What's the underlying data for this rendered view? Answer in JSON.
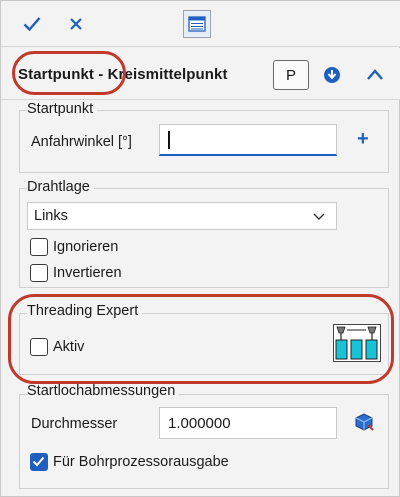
{
  "toolbar": {
    "ok_icon": "checkmark-icon",
    "cancel_icon": "close-icon",
    "table_icon": "table-icon"
  },
  "header": {
    "title": "Startpunkt - Kreismittelpunkt",
    "p_button": "P",
    "down_icon": "circle-arrow-down-icon",
    "collapse_icon": "chevron-up-icon"
  },
  "startpunkt": {
    "group_label": "Startpunkt",
    "field_label": "Anfahrwinkel [°]",
    "field_value": "",
    "add_icon": "plus-icon",
    "add_label": "+"
  },
  "drahtlage": {
    "group_label": "Drahtlage",
    "select_value": "Links",
    "ignorieren_label": "Ignorieren",
    "ignorieren_checked": false,
    "invertieren_label": "Invertieren",
    "invertieren_checked": false
  },
  "threading": {
    "group_label": "Threading Expert",
    "aktiv_label": "Aktiv",
    "aktiv_checked": false,
    "icon": "threading-expert-icon"
  },
  "startloch": {
    "group_label": "Startlochabmessungen",
    "durchmesser_label": "Durchmesser",
    "durchmesser_value": "1.000000",
    "measure_icon": "measure-cube-icon",
    "bohr_label": "Für Bohrprozessorausgabe",
    "bohr_checked": true
  },
  "colors": {
    "accent": "#1f5fbf",
    "highlight_ring": "#c0392b",
    "threading_icon": "#19c3d6"
  }
}
